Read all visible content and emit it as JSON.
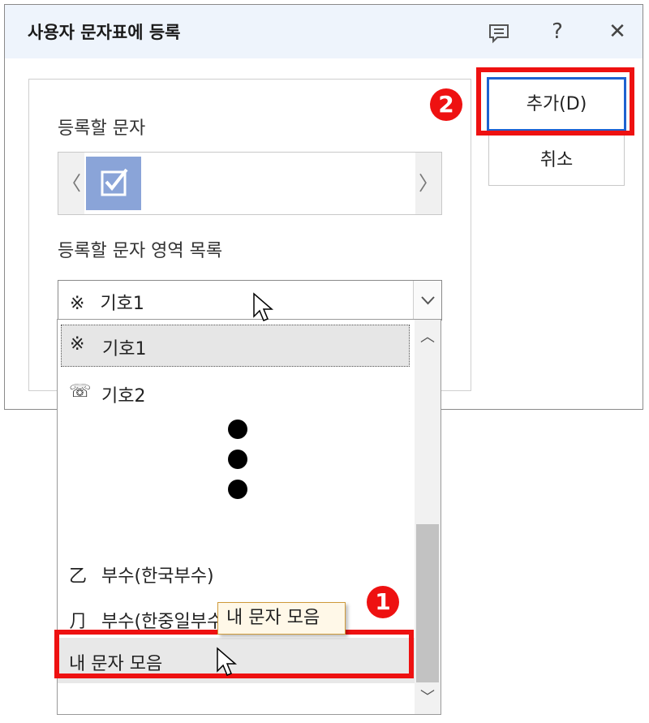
{
  "dialog": {
    "title": "사용자 문자표에 등록",
    "title_buttons": {
      "comment_icon": "comment-icon",
      "help": "?",
      "close": "✕"
    }
  },
  "register_char": {
    "label": "등록할 문자",
    "left_arrow": "〈",
    "right_arrow": "〉",
    "selected_char": "☑"
  },
  "area_list": {
    "label": "등록할 문자 영역 목록",
    "selected_symbol": "※",
    "selected_value": "기호1",
    "dropdown_arrow": "chevron-down-icon"
  },
  "buttons": {
    "add": "추가(D)",
    "cancel": "취소"
  },
  "dropdown": {
    "items": [
      {
        "symbol": "※",
        "label": "기호1"
      },
      {
        "symbol": "☏",
        "label": "기호2"
      },
      {
        "symbol": "乙",
        "label": "부수(한국부수)"
      },
      {
        "symbol": "⺆",
        "label": "부수(한중일부수..."
      },
      {
        "symbol": "",
        "label": "내 문자 모음"
      }
    ],
    "scroll_up": "︿",
    "scroll_down": "﹀"
  },
  "tooltip": "내 문자 모음",
  "annotations": {
    "one": "1",
    "two": "2"
  },
  "colors": {
    "highlight": "#ee1111",
    "accent": "#1e62d0",
    "selected_char_bg": "#8aa4d8"
  }
}
